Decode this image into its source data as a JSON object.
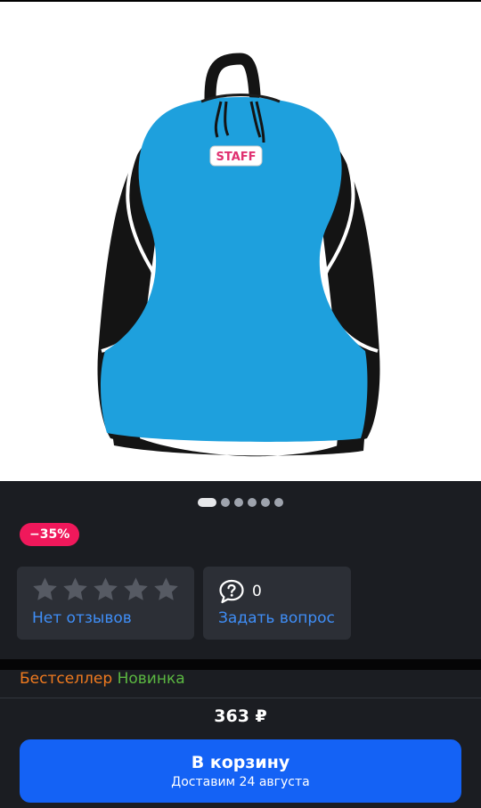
{
  "product": {
    "brand_logo": "STAFF",
    "image_count": 6,
    "active_image": 1,
    "image_colors": {
      "body": "#1ea0dd",
      "sides": "#141414",
      "piping": "#ffffff"
    }
  },
  "discount": {
    "label": "−35%",
    "color": "#f0185b"
  },
  "reviews": {
    "rating": 0,
    "max_stars": 5,
    "label": "Нет отзывов",
    "star_icon": "star-icon"
  },
  "questions": {
    "count": "0",
    "label": "Задать вопрос",
    "icon": "question-bubble-icon"
  },
  "tags": {
    "bestseller": "Бестселлер",
    "new": "Новинка"
  },
  "price": {
    "value": "363 ₽"
  },
  "cart": {
    "label": "В корзину",
    "delivery": "Доставим 24 августа",
    "color": "#1462f5"
  },
  "colors": {
    "background": "#1b1d22",
    "card": "#2c2f36",
    "link": "#3f8ef7"
  }
}
